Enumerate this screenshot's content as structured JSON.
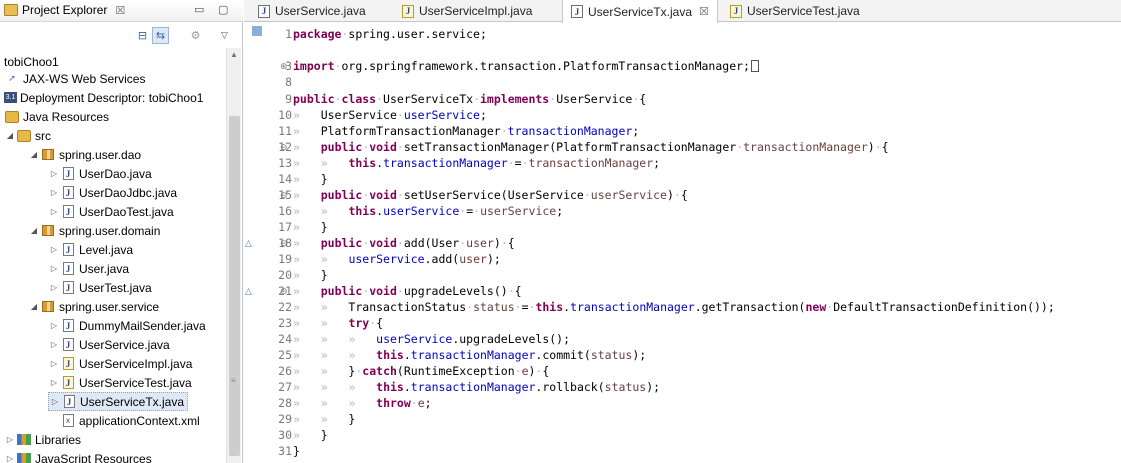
{
  "project_explorer": {
    "title": "Project Explorer",
    "close_glyph": "☒",
    "root": "tobiChoo1",
    "items": [
      {
        "label": "JAX-WS Web Services"
      },
      {
        "label": "Deployment Descriptor: tobiChoo1"
      },
      {
        "label": "Java Resources"
      },
      {
        "label": "src"
      },
      {
        "label": "spring.user.dao"
      },
      {
        "label": "UserDao.java"
      },
      {
        "label": "UserDaoJdbc.java"
      },
      {
        "label": "UserDaoTest.java"
      },
      {
        "label": "spring.user.domain"
      },
      {
        "label": "Level.java"
      },
      {
        "label": "User.java"
      },
      {
        "label": "UserTest.java"
      },
      {
        "label": "spring.user.service"
      },
      {
        "label": "DummyMailSender.java"
      },
      {
        "label": "UserService.java"
      },
      {
        "label": "UserServiceImpl.java"
      },
      {
        "label": "UserServiceTest.java"
      },
      {
        "label": "UserServiceTx.java"
      },
      {
        "label": "applicationContext.xml"
      },
      {
        "label": "Libraries"
      },
      {
        "label": "JavaScript Resources"
      }
    ]
  },
  "editor": {
    "tabs": [
      {
        "label": "UserService.java"
      },
      {
        "label": "UserServiceImpl.java"
      },
      {
        "label": "UserServiceTx.java"
      },
      {
        "label": "UserServiceTest.java"
      }
    ],
    "active_tab": "UserServiceTx.java",
    "line_numbers": [
      "1",
      "3",
      "8",
      "9",
      "10",
      "11",
      "12",
      "13",
      "14",
      "15",
      "16",
      "17",
      "18",
      "19",
      "20",
      "21",
      "22",
      "23",
      "24",
      "25",
      "26",
      "27",
      "28",
      "29",
      "30",
      "31"
    ]
  },
  "colors": {
    "keyword": "#7f0055",
    "field": "#0000c0",
    "variable": "#6a3e3e",
    "selection": "#dfe9f6"
  }
}
